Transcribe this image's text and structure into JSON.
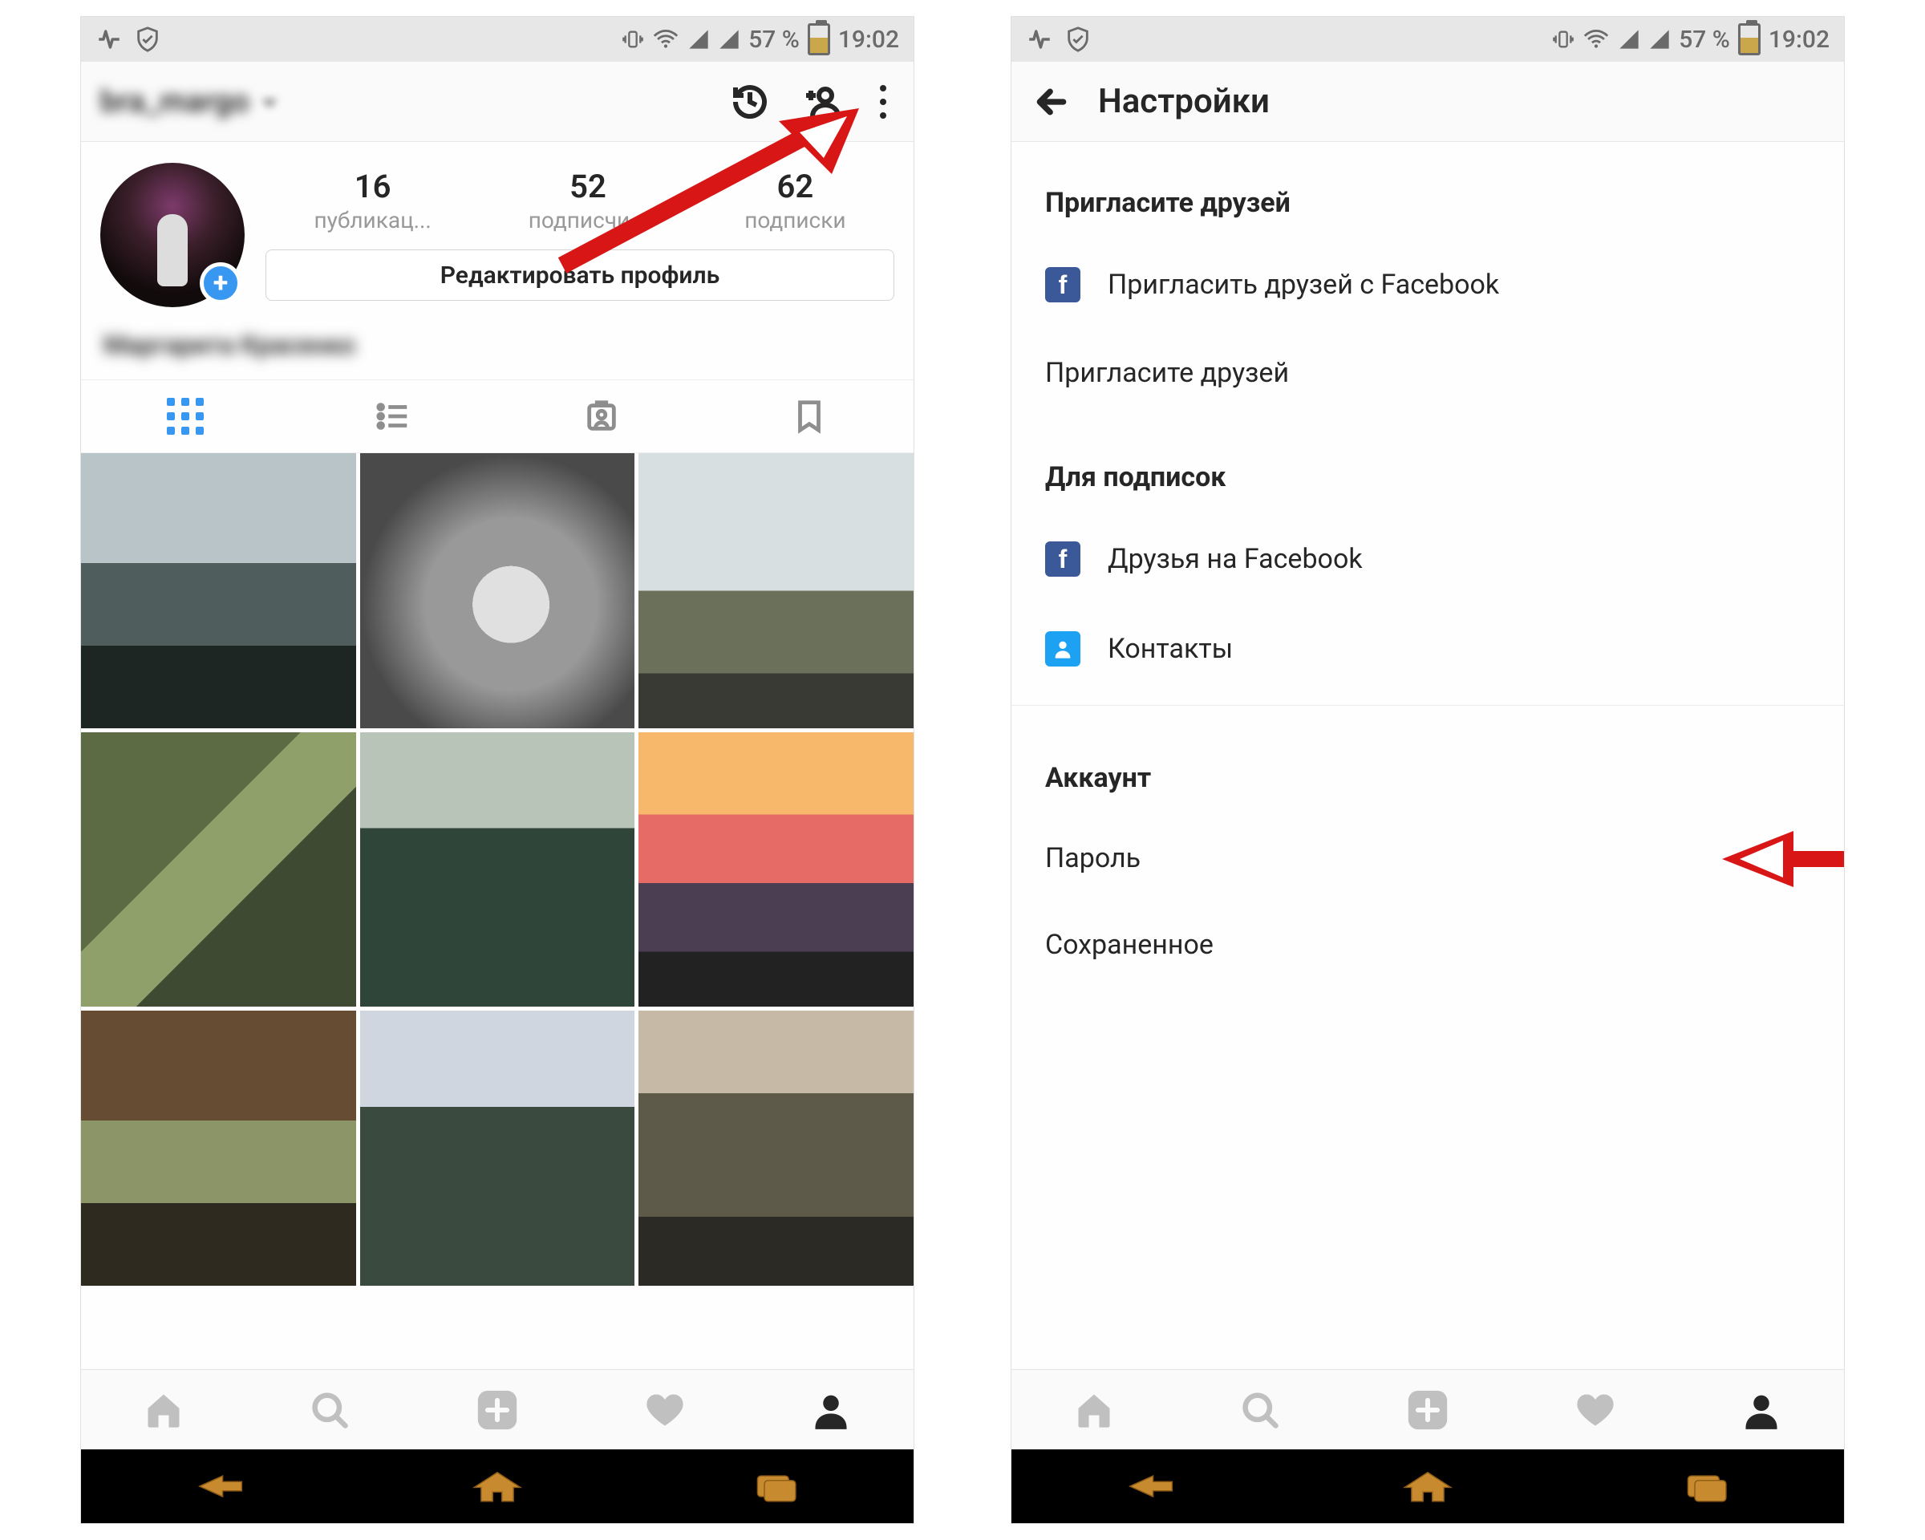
{
  "statusbar": {
    "battery_text": "57 %",
    "time": "19:02"
  },
  "screen1": {
    "username": "bra_margo",
    "stats": {
      "posts": {
        "count": "16",
        "label": "публикац..."
      },
      "followers": {
        "count": "52",
        "label": "подписчи..."
      },
      "following": {
        "count": "62",
        "label": "подписки"
      }
    },
    "edit_profile": "Редактировать профиль",
    "display_name": "Маргарита Красенко"
  },
  "screen2": {
    "title": "Настройки",
    "section_invite": "Пригласите друзей",
    "items": {
      "invite_fb": "Пригласить друзей с Facebook",
      "invite_friends": "Пригласите друзей"
    },
    "section_follow": "Для подписок",
    "items2": {
      "fb_friends": "Друзья на Facebook",
      "contacts": "Контакты"
    },
    "section_account": "Аккаунт",
    "items3": {
      "password": "Пароль",
      "saved": "Сохраненное"
    }
  }
}
